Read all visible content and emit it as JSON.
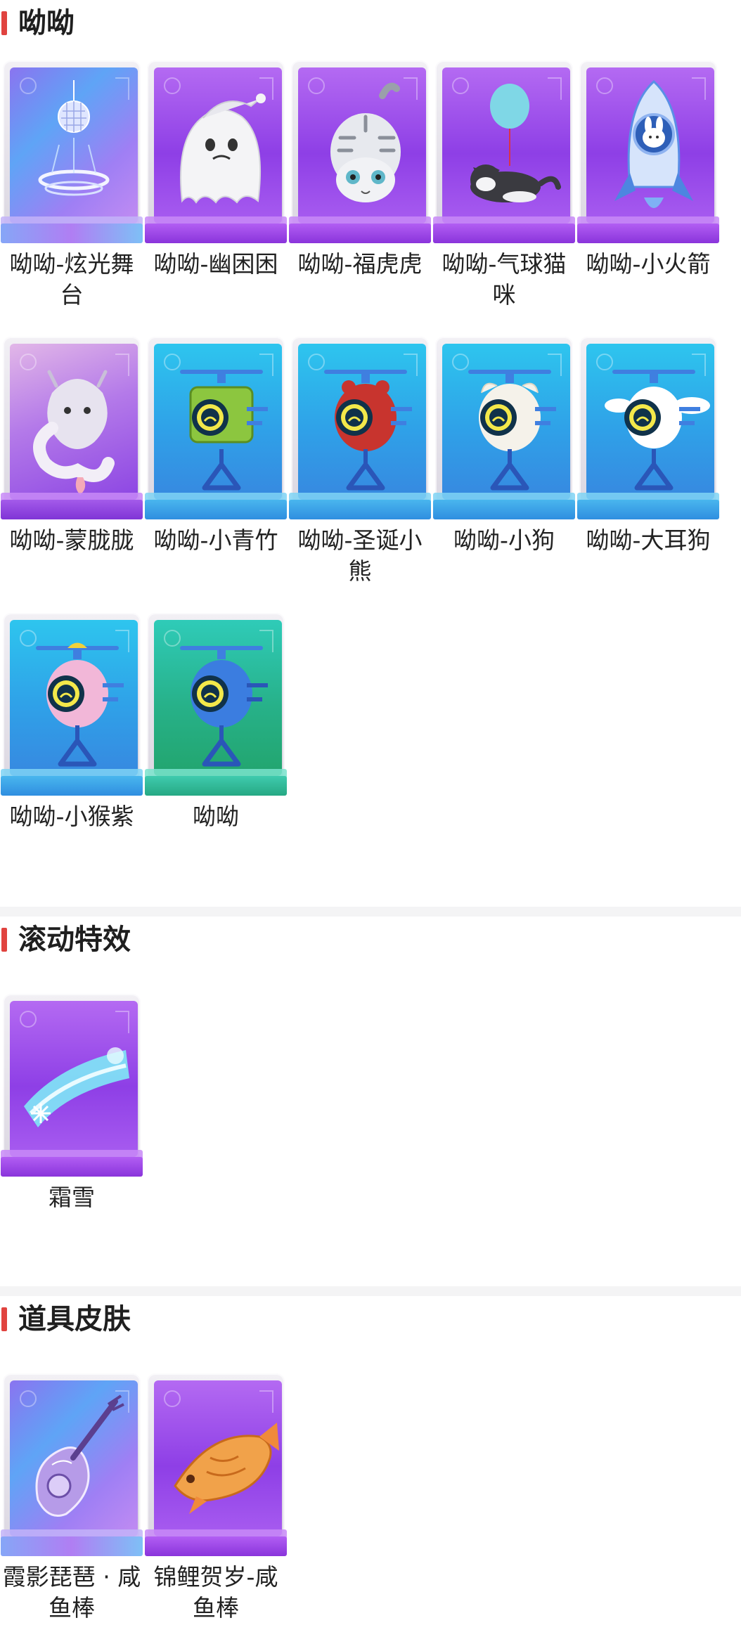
{
  "sections": [
    {
      "title": "呦呦",
      "items": [
        {
          "label": "呦呦-炫光舞台",
          "icon": "disco-stage-icon",
          "theme": "iri"
        },
        {
          "label": "呦呦-幽困困",
          "icon": "ghost-icon",
          "theme": "purple"
        },
        {
          "label": "呦呦-福虎虎",
          "icon": "tiger-icon",
          "theme": "purple"
        },
        {
          "label": "呦呦-气球猫咪",
          "icon": "balloon-cat-icon",
          "theme": "purple"
        },
        {
          "label": "呦呦-小火箭",
          "icon": "rocket-icon",
          "theme": "purple"
        },
        {
          "label": "呦呦-蒙胧胧",
          "icon": "dragon-icon",
          "theme": "pinkpurple"
        },
        {
          "label": "呦呦-小青竹",
          "icon": "green-copter-icon",
          "theme": "blue"
        },
        {
          "label": "呦呦-圣诞小熊",
          "icon": "christmas-bear-copter-icon",
          "theme": "blue"
        },
        {
          "label": "呦呦-小狗",
          "icon": "dog-copter-icon",
          "theme": "blue"
        },
        {
          "label": "呦呦-大耳狗",
          "icon": "big-ear-dog-copter-icon",
          "theme": "blue"
        },
        {
          "label": "呦呦-小猴紫",
          "icon": "monkey-copter-icon",
          "theme": "blue"
        },
        {
          "label": "呦呦",
          "icon": "blue-copter-icon",
          "theme": "green"
        }
      ]
    },
    {
      "title": "滚动特效",
      "items": [
        {
          "label": "霜雪",
          "icon": "frost-trail-icon",
          "theme": "purple"
        }
      ]
    },
    {
      "title": "道具皮肤",
      "items": [
        {
          "label": "霞影琵琶 · 咸鱼棒",
          "icon": "pipa-icon",
          "theme": "iri"
        },
        {
          "label": "锦鲤贺岁-咸鱼棒",
          "icon": "koi-fish-icon",
          "theme": "purple"
        }
      ]
    }
  ],
  "colors": {
    "accent_bar": "#e0433f",
    "divider": "#f4f4f5",
    "label_text": "#222222"
  }
}
